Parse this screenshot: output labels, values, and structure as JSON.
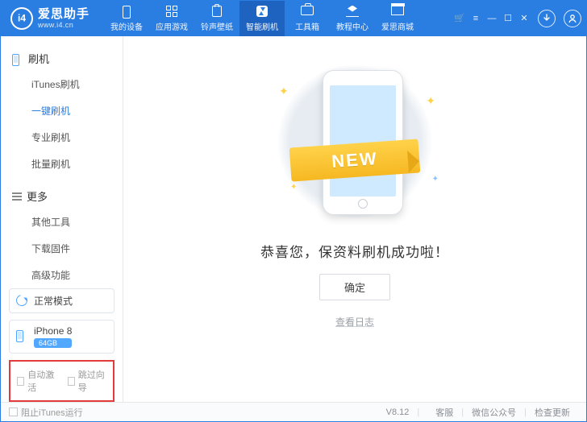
{
  "brand": {
    "cn": "爱思助手",
    "url": "www.i4.cn"
  },
  "tabs": [
    {
      "label": "我的设备"
    },
    {
      "label": "应用游戏"
    },
    {
      "label": "铃声壁纸"
    },
    {
      "label": "智能刷机"
    },
    {
      "label": "工具箱"
    },
    {
      "label": "教程中心"
    },
    {
      "label": "爱思商城"
    }
  ],
  "sidebar": {
    "group1": {
      "title": "刷机",
      "items": [
        "iTunes刷机",
        "一键刷机",
        "专业刷机",
        "批量刷机"
      ]
    },
    "group2": {
      "title": "更多",
      "items": [
        "其他工具",
        "下载固件",
        "高级功能"
      ]
    },
    "mode": "正常模式",
    "device": {
      "name": "iPhone 8",
      "storage": "64GB"
    },
    "auto_activate": "自动激活",
    "skip_guide": "跳过向导"
  },
  "main": {
    "ribbon": "NEW",
    "message": "恭喜您，保资料刷机成功啦！",
    "ok": "确定",
    "log": "查看日志"
  },
  "footer": {
    "block_itunes": "阻止iTunes运行",
    "version": "V8.12",
    "links": [
      "客服",
      "微信公众号",
      "检查更新"
    ]
  }
}
